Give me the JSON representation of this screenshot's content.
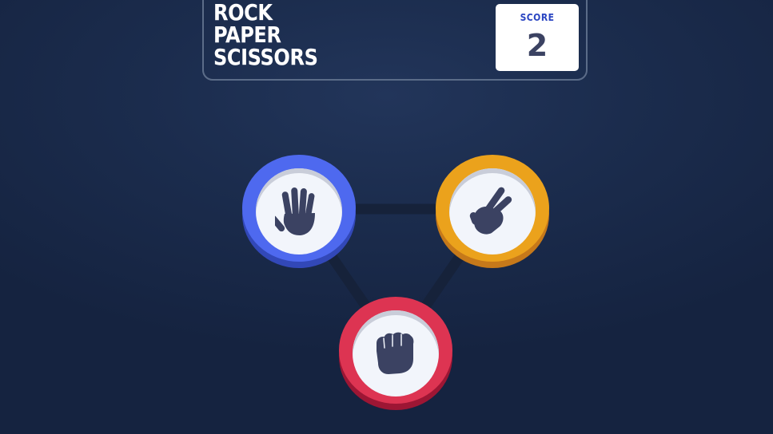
{
  "header": {
    "title_lines": [
      "ROCK",
      "PAPER",
      "SCISSORS"
    ],
    "score_label": "SCORE",
    "score_value": "2"
  },
  "board": {
    "choices": [
      {
        "id": "paper",
        "icon": "paper-hand-icon",
        "color": "#4e69ef"
      },
      {
        "id": "scissors",
        "icon": "scissors-hand-icon",
        "color": "#eba21c"
      },
      {
        "id": "rock",
        "icon": "rock-fist-icon",
        "color": "#dd3452"
      }
    ],
    "icon_color": "#3b4262",
    "background_color": "#1b2c4d"
  }
}
